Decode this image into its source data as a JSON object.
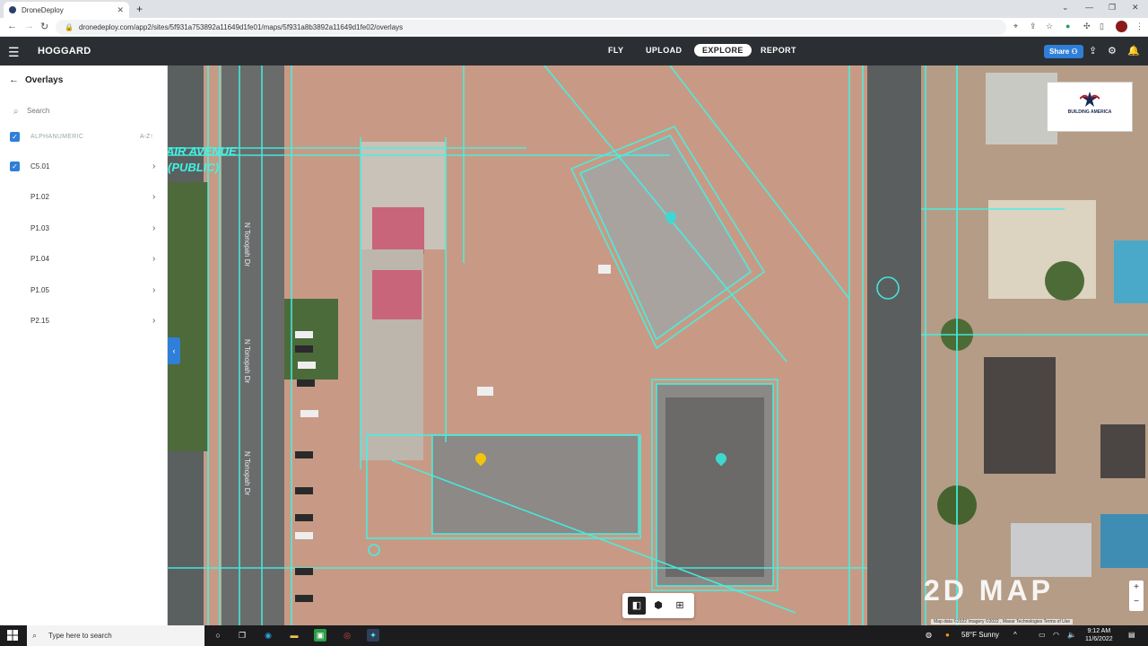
{
  "browser": {
    "tab_title": "DroneDeploy",
    "url": "dronedeploy.com/app2/sites/5f931a753892a11649d1fe01/maps/5f931a8b3892a11649d1fe02/overlays"
  },
  "header": {
    "site_name": "HOGGARD",
    "nav": [
      {
        "label": "FLY"
      },
      {
        "label": "UPLOAD"
      },
      {
        "label": "EXPLORE"
      },
      {
        "label": "REPORT"
      }
    ],
    "share_label": "Share"
  },
  "sidebar": {
    "title": "Overlays",
    "search_placeholder": "Search",
    "sort_header": {
      "label": "ALPHANUMERIC",
      "sort": "A-Z"
    },
    "items": [
      {
        "label": "C5.01",
        "checked": true
      },
      {
        "label": "P1.02",
        "checked": false
      },
      {
        "label": "P1.03",
        "checked": false
      },
      {
        "label": "P1.04",
        "checked": false
      },
      {
        "label": "P1.05",
        "checked": false
      },
      {
        "label": "P2.15",
        "checked": false
      }
    ]
  },
  "map": {
    "mode_label": "2D MAP",
    "attribution": "Map data ©2022 Imagery ©2022 , Maxar Technologies   Terms of Use",
    "street_labels": [
      "AIR AVENUE",
      "(PUBLIC)",
      "N Tonopah Dr",
      "N Tonopah Dr",
      "N Tonopah Dr"
    ],
    "logo_text": "BUILDING AMERICA"
  },
  "taskbar": {
    "search_placeholder": "Type here to search",
    "weather": "58°F  Sunny",
    "time": "9:12 AM",
    "date": "11/6/2022"
  },
  "colors": {
    "accent": "#2f7fd8",
    "header_bg": "#2b2f33",
    "overlay_lines": "#3ff5e6"
  }
}
